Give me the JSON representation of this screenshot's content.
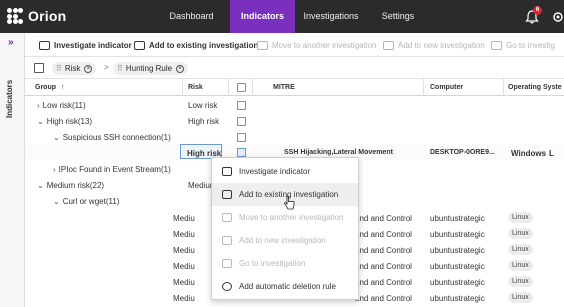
{
  "app": {
    "name": "Orion"
  },
  "nav": {
    "tabs": [
      {
        "label": "Dashboard"
      },
      {
        "label": "Indicators"
      },
      {
        "label": "Investigations"
      },
      {
        "label": "Settings"
      }
    ],
    "active": "Indicators",
    "notification_count": "6"
  },
  "rail": {
    "label": "Indicators",
    "collapse_glyph": "»"
  },
  "toolbar": {
    "investigate_indicator": "Investigate indicator",
    "add_existing": "Add to existing investigation",
    "move_another": "Move to another investigation",
    "add_new": "Add to new investigation",
    "go_to": "Go to investig"
  },
  "filters": {
    "chips": [
      {
        "label": "Risk"
      },
      {
        "label": "Hunting Rule"
      }
    ],
    "arrow": ">"
  },
  "table": {
    "columns": {
      "group": "Group",
      "risk": "Risk",
      "mitre": "MITRE",
      "computer": "Computer",
      "os": "Operating Syste"
    },
    "sort_arrow": "↑",
    "rows": {
      "low": {
        "group": "Low risk",
        "count": "(11)",
        "risk": "Low risk"
      },
      "high": {
        "group": "High risk",
        "count": "(13)",
        "risk": "High risk"
      },
      "ssh": {
        "group": "Suspicious SSH connection",
        "count": "(1)"
      },
      "detail": {
        "risk": "High risk",
        "mitre": "SSH Hijacking,Lateral Movement",
        "computer": "DESKTOP-0ORE9...",
        "os": "Windows",
        "extra": "L"
      },
      "ioc": {
        "group": "IPIoc Found in Event Stream",
        "count": "(1)"
      },
      "medium": {
        "group": "Medium risk",
        "count": "(22)",
        "risk": "Medium"
      },
      "curl": {
        "group": "Curl or wget",
        "count": "(11)"
      },
      "m1": {
        "risk": "Mediu",
        "mitre": "and and Control",
        "computer": "ubuntustrategic",
        "os": "Linux"
      },
      "m2": {
        "risk": "Mediu",
        "mitre": "and and Control",
        "computer": "ubuntustrategic",
        "os": "Linux"
      },
      "m3": {
        "risk": "Mediu",
        "mitre": "and and Control",
        "computer": "ubuntustrategic",
        "os": "Linux"
      },
      "m4": {
        "risk": "Mediu",
        "mitre": "and and Control",
        "computer": "ubuntustrategic",
        "os": "Linux"
      },
      "m5": {
        "risk": "Mediu",
        "mitre": "and and Control",
        "computer": "ubuntustrategic",
        "os": "Linux"
      },
      "m6": {
        "risk": "Mediu",
        "mitre": "and and Control",
        "computer": "ubuntustrategic",
        "os": "Linux"
      },
      "m7": {
        "risk": "Mediu",
        "mitre": "and and Control",
        "computer": "ubuntustrategic",
        "os": "Linux"
      }
    }
  },
  "context_menu": {
    "items": [
      {
        "label": "Investigate indicator",
        "enabled": true
      },
      {
        "label": "Add to existing investigation",
        "enabled": true,
        "hovered": true
      },
      {
        "label": "Move to another investigation",
        "enabled": false
      },
      {
        "label": "Add to new investigation",
        "enabled": false
      },
      {
        "label": "Go to investigation",
        "enabled": false
      },
      {
        "label": "Add automatic deletion rule",
        "enabled": true
      }
    ]
  },
  "colors": {
    "topbar": "#2b2b2b",
    "accent": "#7b2fbe",
    "badge": "#d8262e"
  }
}
